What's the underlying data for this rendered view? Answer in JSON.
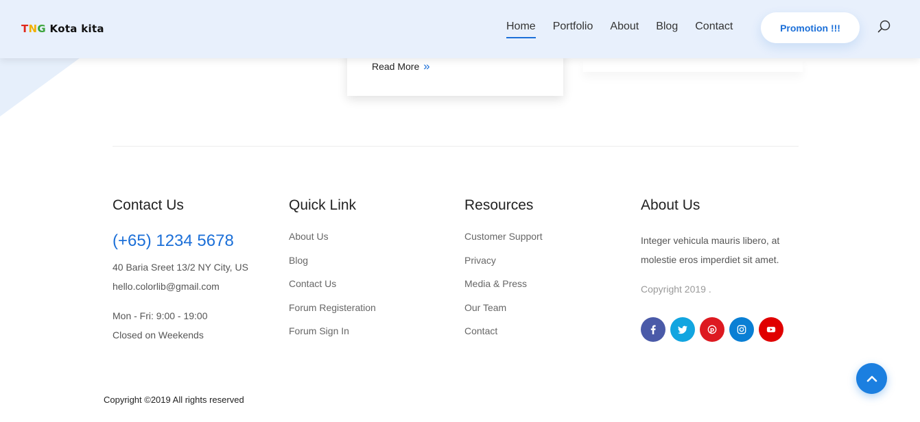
{
  "logo": {
    "t": "T",
    "n": "N",
    "g": "G",
    "rest": " Kota kita"
  },
  "nav": {
    "items": [
      "Home",
      "Portfolio",
      "About",
      "Blog",
      "Contact"
    ],
    "active": "Home"
  },
  "promo_button": "Promotion !!!",
  "card": {
    "read_more": "Read More",
    "chevron": "»"
  },
  "footer": {
    "contact": {
      "title": "Contact Us",
      "phone": "(+65) 1234 5678",
      "address": "40 Baria Sreet 13/2 NY City, US",
      "email": "hello.colorlib@gmail.com",
      "hours": "Mon - Fri: 9:00 - 19:00",
      "closed": "Closed on Weekends"
    },
    "quick_link": {
      "title": "Quick Link",
      "links": [
        "About Us",
        "Blog",
        "Contact Us",
        "Forum Registeration",
        "Forum Sign In"
      ]
    },
    "resources": {
      "title": "Resources",
      "links": [
        "Customer Support",
        "Privacy",
        "Media & Press",
        "Our Team",
        "Contact"
      ]
    },
    "about": {
      "title": "About Us",
      "text": "Integer vehicula mauris libero, at molestie eros imperdiet sit amet.",
      "copyright": "Copyright 2019 ."
    },
    "social": [
      {
        "name": "facebook-icon",
        "color": "#3b5998"
      },
      {
        "name": "twitter-icon",
        "color": "#1da1f2"
      },
      {
        "name": "pinterest-icon",
        "color": "#e60023"
      },
      {
        "name": "instagram-icon",
        "color": "#0a7fd4"
      },
      {
        "name": "youtube-icon",
        "color": "#e00000"
      }
    ]
  },
  "bottom_copyright": "Copyright ©2019 All rights reserved",
  "colors": {
    "accent": "#1b6fd8",
    "header_bg": "#e8f0fc"
  }
}
